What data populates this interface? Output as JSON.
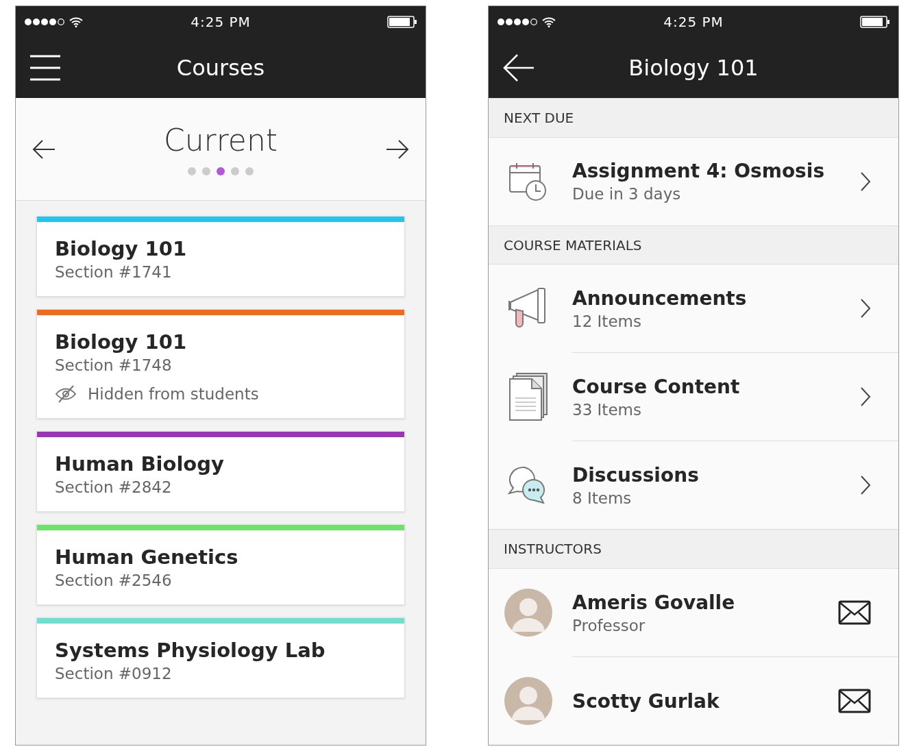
{
  "left_screen": {
    "status_bar": {
      "time": "4:25 PM"
    },
    "title": "Courses",
    "term": {
      "label": "Current",
      "pages": [
        {
          "selected": false
        },
        {
          "selected": false
        },
        {
          "selected": true
        },
        {
          "selected": false
        },
        {
          "selected": false
        }
      ]
    },
    "courses": [
      {
        "title": "Biology 101",
        "section": "Section #1741",
        "color": "#29c4ec"
      },
      {
        "title": "Biology 101",
        "section": "Section #1748",
        "color": "#f26a1b",
        "note": "Hidden from students"
      },
      {
        "title": "Human Biology",
        "section": "Section #2842",
        "color": "#9b34b8"
      },
      {
        "title": "Human Genetics",
        "section": "Section #2546",
        "color": "#6ee26a"
      },
      {
        "title": "Systems Physiology Lab",
        "section": "Section #0912",
        "color": "#6fe0cf"
      }
    ]
  },
  "right_screen": {
    "status_bar": {
      "time": "4:25 PM"
    },
    "title": "Biology 101",
    "sections": [
      {
        "heading": "NEXT DUE",
        "items": [
          {
            "kind": "assignment",
            "title": "Assignment 4: Osmosis",
            "subtitle": "Due in 3 days"
          }
        ]
      },
      {
        "heading": "COURSE MATERIALS",
        "items": [
          {
            "kind": "announcements",
            "title": "Announcements",
            "subtitle": "12 Items"
          },
          {
            "kind": "content",
            "title": "Course Content",
            "subtitle": "33 Items"
          },
          {
            "kind": "discussions",
            "title": "Discussions",
            "subtitle": "8 Items"
          }
        ]
      },
      {
        "heading": "INSTRUCTORS",
        "items": [
          {
            "kind": "person",
            "title": "Ameris Govalle",
            "subtitle": "Professor"
          },
          {
            "kind": "person",
            "title": "Scotty Gurlak"
          }
        ]
      }
    ]
  }
}
